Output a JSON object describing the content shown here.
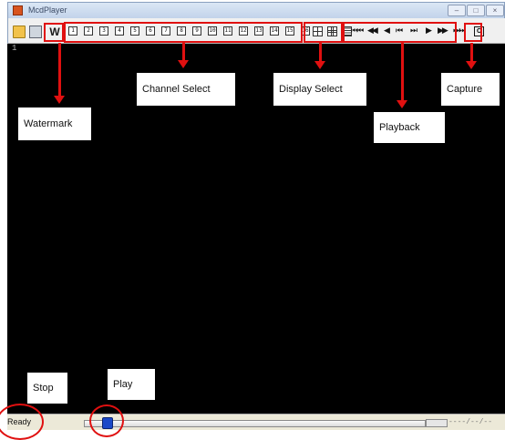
{
  "window": {
    "title": "McdPlayer"
  },
  "toolbar": {
    "watermark_label": "W",
    "channels": [
      "1",
      "2",
      "3",
      "4",
      "5",
      "6",
      "7",
      "8",
      "9",
      "10",
      "11",
      "12",
      "13",
      "14",
      "15",
      "16"
    ],
    "display_modes": [
      "grid-4",
      "grid-9",
      "grid-16"
    ],
    "playback": [
      "⏮⏮",
      "◀◀",
      "◀",
      "⏮",
      "⏭",
      "▶",
      "▶▶",
      "⏭⏭"
    ],
    "capture_label": "C"
  },
  "video": {
    "channel_number": "1"
  },
  "statusbar": {
    "status": "Ready",
    "time": "----/--/--"
  },
  "annotations": {
    "watermark": "Watermark",
    "channel_select": "Channel Select",
    "display_select": "Display Select",
    "playback": "Playback",
    "capture": "Capture",
    "stop": "Stop",
    "play": "Play"
  },
  "colors": {
    "annotation": "#e01010",
    "video_bg": "#000000",
    "seek_thumb": "#1c49c8"
  }
}
